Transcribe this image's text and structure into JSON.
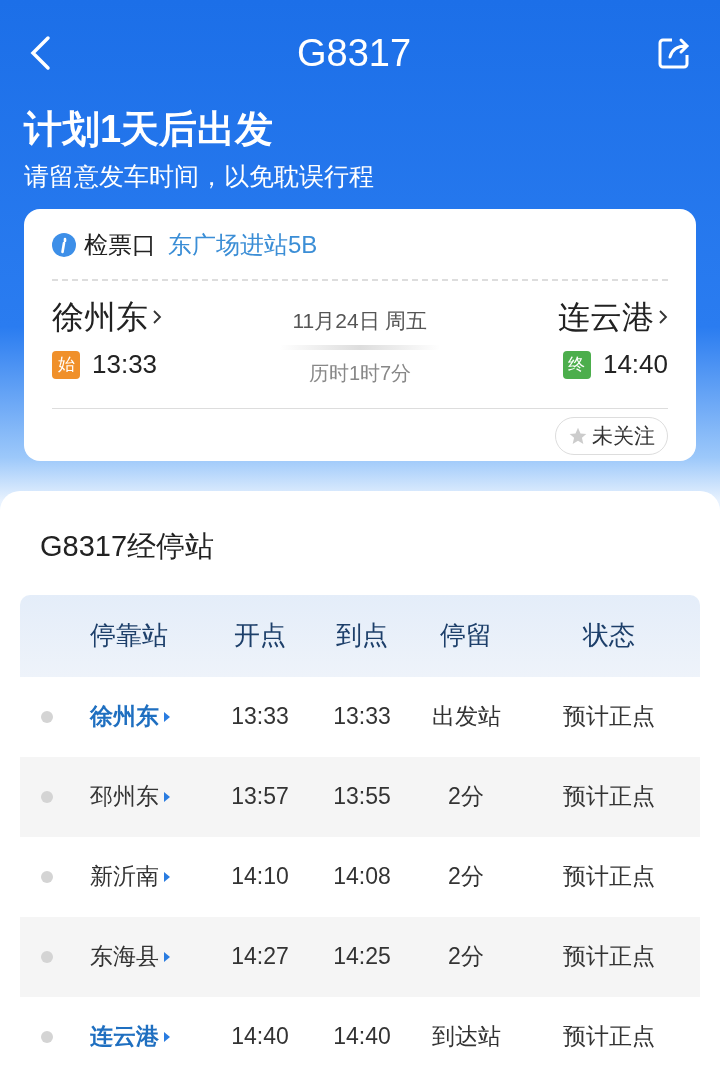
{
  "header": {
    "title": "G8317",
    "headline": "计划1天后出发",
    "subtitle": "请留意发车时间，以免耽误行程"
  },
  "trip_card": {
    "gate_label": "检票口",
    "gate": "东广场进站5B",
    "departure": {
      "station": "徐州东",
      "badge": "始",
      "time": "13:33"
    },
    "date": "11月24日 周五",
    "duration": "历时1时7分",
    "arrival": {
      "station": "连云港",
      "badge": "终",
      "time": "14:40"
    },
    "follow": {
      "label": "未关注",
      "followed": false
    }
  },
  "stops": {
    "title": "G8317经停站",
    "columns": [
      "停靠站",
      "开点",
      "到点",
      "停留",
      "状态"
    ],
    "rows": [
      {
        "kind": "terminal",
        "station": "徐州东",
        "depart": "13:33",
        "arrive": "13:33",
        "stay": "出发站",
        "status": "预计正点"
      },
      {
        "kind": "stop",
        "station": "邳州东",
        "depart": "13:57",
        "arrive": "13:55",
        "stay": "2分",
        "status": "预计正点"
      },
      {
        "kind": "stop",
        "station": "新沂南",
        "depart": "14:10",
        "arrive": "14:08",
        "stay": "2分",
        "status": "预计正点"
      },
      {
        "kind": "stop",
        "station": "东海县",
        "depart": "14:27",
        "arrive": "14:25",
        "stay": "2分",
        "status": "预计正点"
      },
      {
        "kind": "terminal",
        "station": "连云港",
        "depart": "14:40",
        "arrive": "14:40",
        "stay": "到达站",
        "status": "预计正点"
      }
    ]
  }
}
